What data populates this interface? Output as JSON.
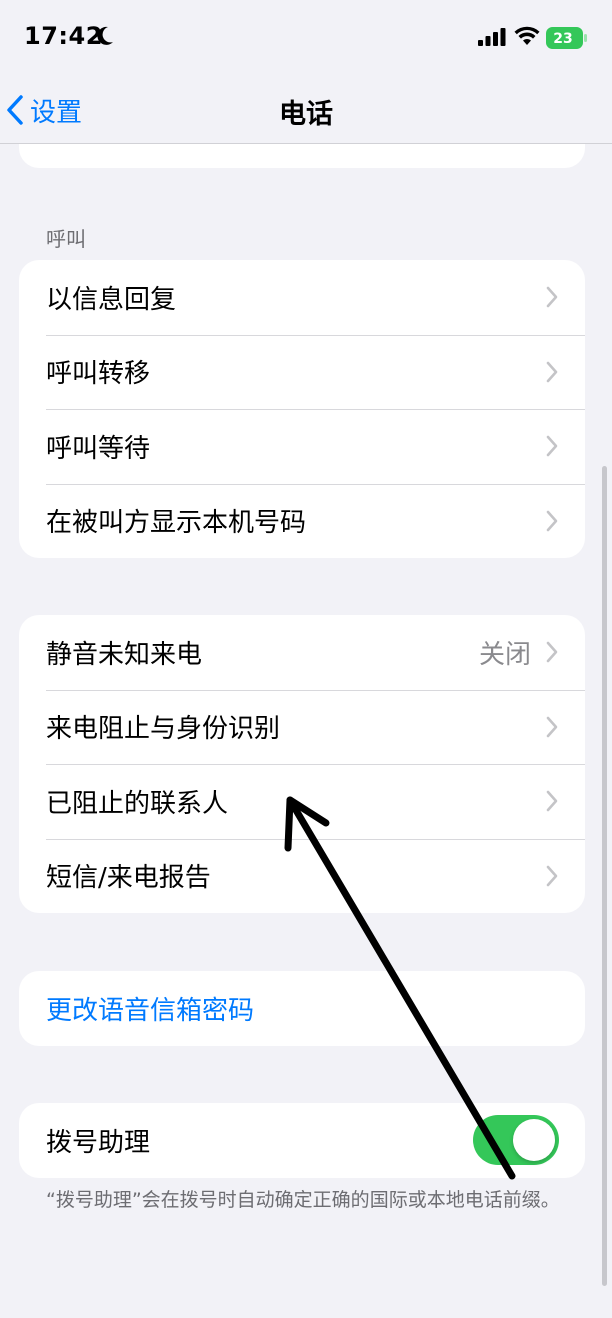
{
  "status_bar": {
    "time": "17:42",
    "battery_level": "23"
  },
  "nav": {
    "back_label": "设置",
    "title": "电话"
  },
  "calls_section": {
    "header": "呼叫",
    "items": [
      {
        "label": "以信息回复"
      },
      {
        "label": "呼叫转移"
      },
      {
        "label": "呼叫等待"
      },
      {
        "label": "在被叫方显示本机号码"
      }
    ]
  },
  "blocking_section": {
    "items": [
      {
        "label": "静音未知来电",
        "value": "关闭"
      },
      {
        "label": "来电阻止与身份识别"
      },
      {
        "label": "已阻止的联系人"
      },
      {
        "label": "短信/来电报告"
      }
    ]
  },
  "voicemail": {
    "change_password_label": "更改语音信箱密码"
  },
  "dial_assist": {
    "label": "拨号助理",
    "enabled": true,
    "footer": "“拨号助理”会在拨号时自动确定正确的国际或本地电话前缀。"
  },
  "colors": {
    "accent": "#007aff",
    "toggle_on": "#34c759",
    "background": "#f2f2f7"
  }
}
